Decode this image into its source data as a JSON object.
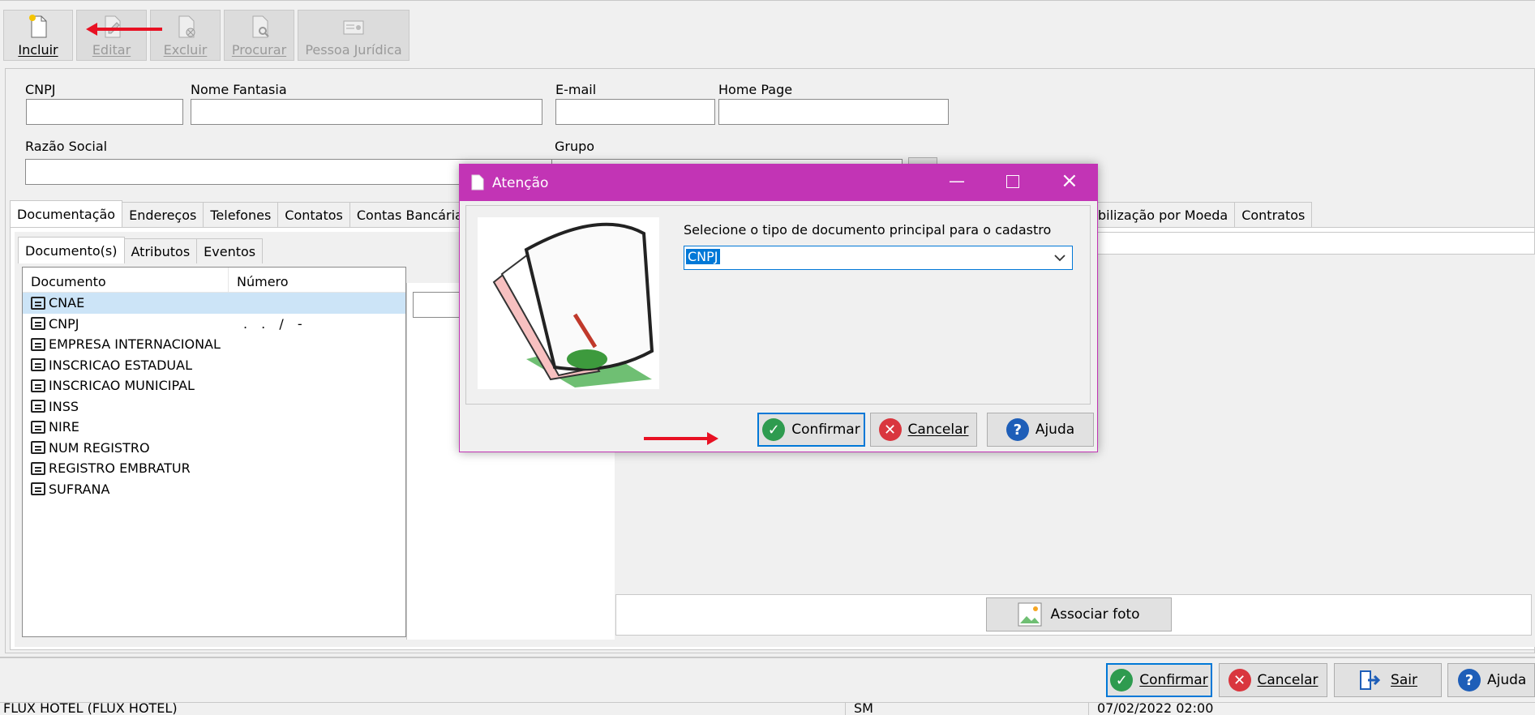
{
  "toolbar": {
    "buttons": [
      {
        "label": "Incluir",
        "icon": "new-document-icon",
        "enabled": true
      },
      {
        "label": "Editar",
        "icon": "edit-document-icon",
        "enabled": false
      },
      {
        "label": "Excluir",
        "icon": "delete-document-icon",
        "enabled": false
      },
      {
        "label": "Procurar",
        "icon": "search-document-icon",
        "enabled": false
      },
      {
        "label": "Pessoa Jurídica",
        "icon": "company-card-icon",
        "enabled": false
      }
    ]
  },
  "form": {
    "cnpj_label": "CNPJ",
    "nome_fantasia_label": "Nome Fantasia",
    "email_label": "E-mail",
    "home_page_label": "Home Page",
    "razao_social_label": "Razão Social",
    "grupo_label": "Grupo"
  },
  "main_tabs": [
    "Documentação",
    "Endereços",
    "Telefones",
    "Contatos",
    "Contas Bancárias",
    "bilização por Moeda",
    "Contratos"
  ],
  "sub_tabs": [
    "Documento(s)",
    "Atributos",
    "Eventos"
  ],
  "documents": {
    "columns": [
      "Documento",
      "Número"
    ],
    "rows": [
      {
        "name": "CNAE",
        "number": ""
      },
      {
        "name": "CNPJ",
        "number": ". . / -"
      },
      {
        "name": "EMPRESA INTERNACIONAL",
        "number": ""
      },
      {
        "name": "INSCRICAO ESTADUAL",
        "number": ""
      },
      {
        "name": "INSCRICAO MUNICIPAL",
        "number": ""
      },
      {
        "name": "INSS",
        "number": ""
      },
      {
        "name": "NIRE",
        "number": ""
      },
      {
        "name": "NUM REGISTRO",
        "number": ""
      },
      {
        "name": "REGISTRO EMBRATUR",
        "number": ""
      },
      {
        "name": "SUFRANA",
        "number": ""
      }
    ]
  },
  "photo": {
    "associar_label": "Associar foto"
  },
  "bottom_buttons": {
    "confirmar": "Confirmar",
    "cancelar": "Cancelar",
    "sair": "Sair",
    "ajuda": "Ajuda"
  },
  "status_bar": {
    "left": "FLUX HOTEL (FLUX HOTEL)",
    "middle": "SM",
    "right": "07/02/2022 02:00"
  },
  "dialog": {
    "title": "Atenção",
    "prompt": "Selecione o tipo de documento principal para o cadastro",
    "selected_value": "CNPJ",
    "confirmar": "Confirmar",
    "cancelar": "Cancelar",
    "ajuda": "Ajuda"
  },
  "colors": {
    "dialog_accent": "#c234b5",
    "selection": "#cce4f7",
    "focus_blue": "#0078d7",
    "arrow_red": "#e81123"
  }
}
